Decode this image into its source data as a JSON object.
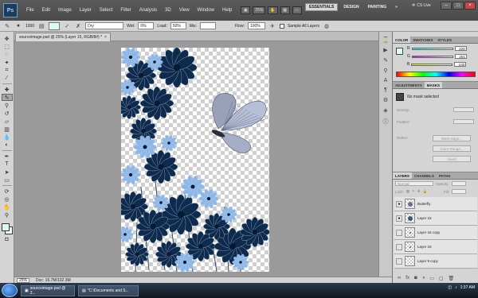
{
  "app": {
    "logo": "Ps",
    "menus": [
      "File",
      "Edit",
      "Image",
      "Layer",
      "Select",
      "Filter",
      "Analysis",
      "3D",
      "View",
      "Window",
      "Help"
    ],
    "zoom_control": "25%",
    "workspaces": [
      "ESSENTIALS",
      "DESIGN",
      "PAINTING"
    ],
    "active_workspace": "ESSENTIALS",
    "more_workspaces": "»",
    "cs_live": "CS Live"
  },
  "options_bar": {
    "brush_size": "1000",
    "mode_value": "Dry",
    "wet_label": "Wet:",
    "wet_value": "0%",
    "load_label": "Load:",
    "load_value": "50%",
    "mix_label": "Mix:",
    "flow_label": "Flow:",
    "flow_value": "100%",
    "sample_all_layers": "Sample All Layers"
  },
  "document": {
    "tab_title": "sourceimage.psd @ 25% (Layer 15, RGB/8#) *",
    "close": "×"
  },
  "status_bar": {
    "zoom": "25%",
    "doc_info": "Doc: 16.7M/102.3M"
  },
  "color_panel": {
    "tabs": [
      "COLOR",
      "SWATCHES",
      "STYLES"
    ],
    "active_tab": "COLOR",
    "r_label": "R",
    "g_label": "G",
    "b_label": "B",
    "r_value": "220",
    "g_value": "251",
    "b_value": "240",
    "swatch_color": "#dcfbf0"
  },
  "adjustments_panel": {
    "tabs": [
      "ADJUSTMENTS",
      "MASKS"
    ],
    "active_tab": "MASKS",
    "mask_status": "No mask selected",
    "density_label": "Density:",
    "feather_label": "Feather:",
    "refine_label": "Refine:",
    "mask_edge": "Mask Edge...",
    "color_range": "Color Range...",
    "invert": "Invert"
  },
  "layers_panel": {
    "tabs": [
      "LAYERS",
      "CHANNELS",
      "PATHS"
    ],
    "active_tab": "LAYERS",
    "blend_mode": "Normal",
    "opacity_label": "Opacity:",
    "lock_label": "Lock:",
    "fill_label": "Fill:",
    "layers": [
      {
        "name": "Butterfly",
        "visible": true
      },
      {
        "name": "Layer 15",
        "visible": true
      },
      {
        "name": "Layer 18 copy",
        "visible": false
      },
      {
        "name": "Layer 18",
        "visible": false
      },
      {
        "name": "Layer 9 copy",
        "visible": false
      }
    ]
  },
  "taskbar": {
    "tasks": [
      "sourceimage.psd @ 2...",
      "\"C:\\Documents and S..."
    ],
    "time": "1:37 AM"
  },
  "colors": {
    "foreground": "#dcfbf0",
    "background": "#ffffff",
    "flower_dark": "#0e2a4d",
    "flower_light": "#8db7e6"
  }
}
